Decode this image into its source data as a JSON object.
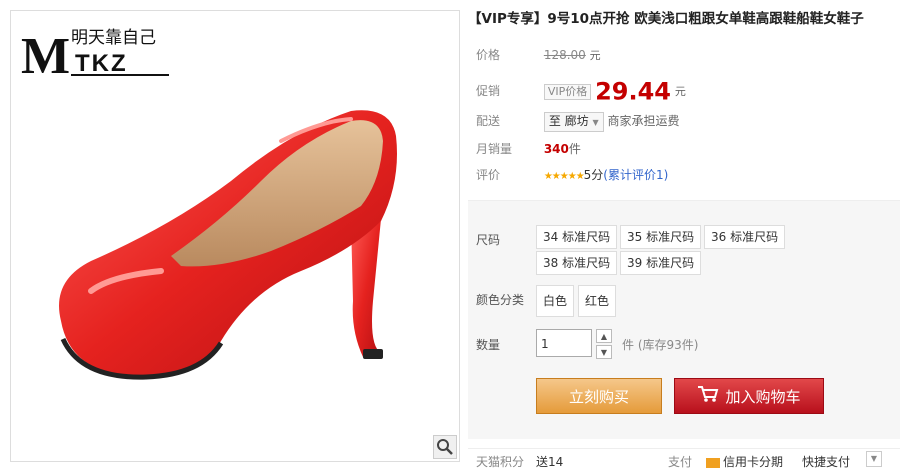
{
  "brand": {
    "logo_text": "MTKZ",
    "logo_cn": "明天靠自己"
  },
  "product": {
    "title": "【VIP专享】9号10点开抢 欧美浅口粗跟女单鞋高跟鞋船鞋女鞋子"
  },
  "price": {
    "label": "价格",
    "original": "128.00",
    "unit": "元"
  },
  "promo": {
    "label": "促销",
    "tag": "VIP价格",
    "price": "29.44",
    "unit": "元"
  },
  "shipping": {
    "label": "配送",
    "to": "至 廊坊",
    "note": "商家承担运费"
  },
  "sales": {
    "label": "月销量",
    "count": "340",
    "unit": "件"
  },
  "rating": {
    "label": "评价",
    "stars": "★★★★★",
    "score": "5分",
    "reviews": "(累计评价1)"
  },
  "size": {
    "label": "尺码",
    "options": [
      "34 标准尺码",
      "35 标准尺码",
      "36 标准尺码",
      "38 标准尺码",
      "39 标准尺码"
    ]
  },
  "color": {
    "label": "颜色分类",
    "options": [
      "白色",
      "红色"
    ]
  },
  "quantity": {
    "label": "数量",
    "value": "1",
    "stock": "件 (库存93件)"
  },
  "actions": {
    "buy": "立刻购买",
    "cart": "加入购物车"
  },
  "footer": {
    "points_label": "天猫积分",
    "points_value": "送14",
    "pay_label": "支付",
    "card": "信用卡分期",
    "quick": "快捷支付"
  },
  "colors": {
    "price_red": "#c40000",
    "buy_orange": "#e59b3a",
    "cart_red": "#b8101c"
  }
}
